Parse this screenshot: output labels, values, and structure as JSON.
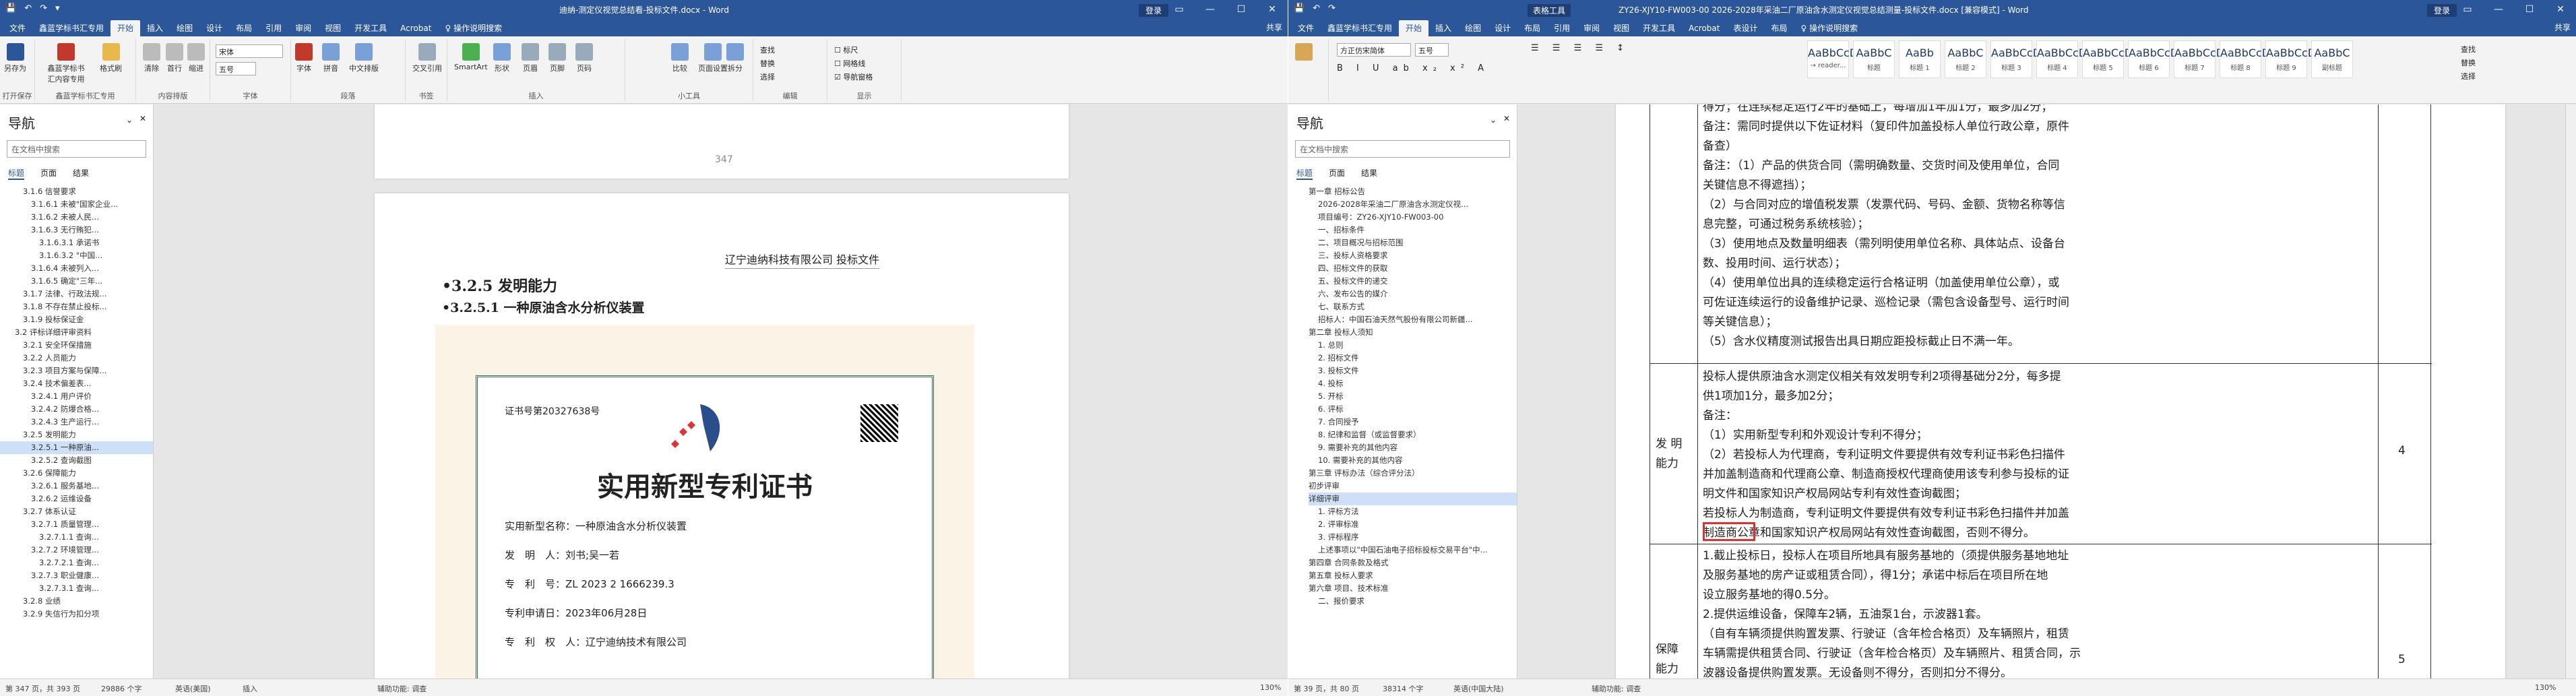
{
  "left": {
    "title": "迪纳-测定仪视觉总结看-投标文件.docx  -  Word",
    "login": "登录",
    "tabs": [
      "文件",
      "鑫蓝学标书汇专用",
      "开始",
      "插入",
      "绘图",
      "设计",
      "布局",
      "引用",
      "审阅",
      "视图",
      "开发工具",
      "Acrobat",
      "♀ 操作说明搜索"
    ],
    "share": "共享",
    "ribbon": {
      "groups": [
        "打开保存",
        "鑫蓝学标书汇专用",
        "内容排版",
        "字体",
        "段落",
        "书签",
        "插入",
        "小工具",
        "编辑",
        "显示"
      ],
      "buttons": [
        "另存为",
        "鑫蓝学标书汇内容专用",
        "格式刷",
        "清除",
        "首行",
        "缩进",
        "样式",
        "字体",
        "拼音",
        "中文排版",
        "页眉",
        "页脚",
        "页码",
        "目录",
        "比较",
        "页面设置",
        "拆分",
        "交叉引用",
        "SmartArt",
        "形状",
        "图片",
        "插图"
      ],
      "font_name": "宋体",
      "font_size": "五号",
      "find": "查找",
      "replace": "替换",
      "select": "选择",
      "show": [
        "标尺",
        "网格线",
        "导航窗格"
      ]
    },
    "nav": {
      "title": "导航",
      "search": "在文档中搜索",
      "tabs": [
        "标题",
        "页面",
        "结果"
      ],
      "items": [
        "3.1.6 信誉要求",
        "3.1.6.1 未被\"国家企业...",
        "3.1.6.2 未被人民...",
        "3.1.6.3 无行贿犯...",
        "3.1.6.3.1 承诺书",
        "3.1.6.3.2 \"中国...",
        "3.1.6.4 未被列入...",
        "3.1.6.5 确定\"三年...",
        "3.1.7 法律、行政法规...",
        "3.1.8 不存在禁止投标...",
        "3.1.9 投标保证金",
        "3.2 评标详细评审资料",
        "3.2.1 安全环保措施",
        "3.2.2 人员能力",
        "3.2.3 项目方案与保障...",
        "3.2.4 技术偏差表...",
        "3.2.4.1 用户评价",
        "3.2.4.2 防爆合格...",
        "3.2.4.3 生产运行...",
        "3.2.5 发明能力",
        "3.2.5.1 一种原油...",
        "3.2.5.2 查询截图",
        "3.2.6 保障能力",
        "3.2.6.1 服务基地...",
        "3.2.6.2 运维设备",
        "3.2.7 体系认证",
        "3.2.7.1 质量管理...",
        "3.2.7.1.1 查询...",
        "3.2.7.2 环境管理...",
        "3.2.7.2.1 查询...",
        "3.2.7.3 职业健康...",
        "3.2.7.3.1 查询...",
        "3.2.8 业绩",
        "3.2.9 失信行为扣分项"
      ]
    },
    "doc": {
      "prev_page_num": "347",
      "header": "辽宁迪纳科技有限公司        投标文件",
      "h1": "•3.2.5 发明能力",
      "h2": "•3.2.5.1 一种原油含水分析仪装置",
      "cert_no": "证书号第20327638号",
      "cert_title": "实用新型专利证书",
      "cert_lines": [
        "实用新型名称：一种原油含水分析仪装置",
        "发　明　人：刘书;吴一若",
        "专　利　号：ZL 2023 2 1666239.3",
        "专利申请日：2023年06月28日",
        "专　利　权　人：辽宁迪纳技术有限公司"
      ]
    },
    "status": [
      "第 347 页，共 393 页",
      "29886 个字",
      "英语(美国)",
      "插入",
      "辅助功能: 调查",
      "130%"
    ]
  },
  "right": {
    "title": "ZY26-XJY10-FW003-00 2026-2028年采油二厂原油含水测定仪视觉总结测量-投标文件.docx [兼容模式]  -  Word",
    "login": "登录",
    "tabs": [
      "文件",
      "鑫蓝学标书汇专用",
      "开始",
      "插入",
      "绘图",
      "设计",
      "布局",
      "引用",
      "审阅",
      "视图",
      "开发工具",
      "Acrobat",
      "表设计",
      "布局",
      "♀ 操作说明搜索"
    ],
    "context_tool": "表格工具",
    "share": "共享",
    "styles": [
      {
        "s": "AaBbCcDc",
        "n": "→ reader..."
      },
      {
        "s": "AaBbC",
        "n": "标题"
      },
      {
        "s": "AaBb",
        "n": "标题 1"
      },
      {
        "s": "AaBbC",
        "n": "标题 2"
      },
      {
        "s": "AaBbCcD",
        "n": "标题 3"
      },
      {
        "s": "AaBbCcDd",
        "n": "标题 4"
      },
      {
        "s": "AaBbCcD",
        "n": "标题 5"
      },
      {
        "s": "AaBbCcDd",
        "n": "标题 6"
      },
      {
        "s": "AaBbCcDd",
        "n": "标题 7"
      },
      {
        "s": "AaBbCcDd",
        "n": "标题 8"
      },
      {
        "s": "AaBbCcDd",
        "n": "标题 9"
      },
      {
        "s": "AaBbC",
        "n": "副标题"
      }
    ],
    "font_name": "方正仿宋简体",
    "font_size": "五号",
    "nav": {
      "title": "导航",
      "search": "在文档中搜索",
      "tabs": [
        "标题",
        "页面",
        "结果"
      ],
      "items": [
        "第一章  招标公告",
        "2026-2028年采油二厂原油含水测定仪视...",
        "项目编号：ZY26-XJY10-FW003-00",
        "一、招标条件",
        "二、项目概况与招标范围",
        "三、投标人资格要求",
        "四、招标文件的获取",
        "五、投标文件的递交",
        "六、发布公告的媒介",
        "七、联系方式",
        "招标人：中国石油天然气股份有限公司新疆...",
        "第二章  投标人须知",
        "1. 总则",
        "2. 招标文件",
        "3. 投标文件",
        "4. 投标",
        "5. 开标",
        "6. 评标",
        "7. 合同授予",
        "8. 纪律和监督（或监督要求）",
        "9. 需要补充的其他内容",
        "10. 需要补充的其他内容",
        "第三章  评标办法（综合评分法）",
        "初步评审",
        "详细评审",
        "1. 评标方法",
        "2. 评审标准",
        "3. 评标程序",
        "上述事项以\"中国石油电子招标投标交易平台\"中...",
        "第四章  合同条款及格式",
        "第五章  投标人要求",
        "第六章  项目、技术标准",
        "二、报价要求"
      ]
    },
    "table": {
      "upper": [
        "得分；在连续稳定运行2年的基础上，每增加1年加1分，最多加2分；",
        "备注：需同时提供以下佐证材料（复印件加盖投标人单位行政公章，原件",
        "备查）",
        "备注：（1）产品的供货合同（需明确数量、交货时间及使用单位，合同",
        "关键信息不得遮挡）；",
        "（2）与合同对应的增值税发票（发票代码、号码、金额、货物名称等信",
        "息完整，可通过税务系统核验）；",
        "（3）使用地点及数量明细表（需列明使用单位名称、具体站点、设备台",
        "数、投用时间、运行状态）；",
        "（4）使用单位出具的连续稳定运行合格证明（加盖使用单位公章），或",
        "可佐证连续运行的设备维护记录、巡检记录（需包含设备型号、运行时间",
        "等关键信息）；",
        "（5）含水仪精度测试报告出具日期应距投标截止日不满一年。"
      ],
      "middle_label": [
        "发 明",
        "能力"
      ],
      "middle": [
        "投标人提供原油含水测定仪相关有效发明专利2项得基础分2分，每多提",
        "供1项加1分，最多加2分；",
        "备注：",
        "（1）实用新型专利和外观设计专利不得分；",
        "（2）若投标人为代理商，专利证明文件要提供有效专利证书彩色扫描件",
        "并加盖制造商和代理商公章、制造商授权代理商使用该专利参与投标的证",
        "明文件和国家知识产权局网站专利有效性查询截图；",
        "若投标人为制造商，专利证明文件要提供有效专利证书彩色扫描件并加盖",
        "制造商公章和国家知识产权局网站有效性查询截图，否则不得分。"
      ],
      "middle_score": "4",
      "lower_label": [
        "保障",
        "能力"
      ],
      "lower": [
        "1.截止投标日，投标人在项目所地具有服务基地的（须提供服务基地地址",
        "及服务基地的房产证或租赁合同），得1分；承诺中标后在项目所在地",
        "设立服务基地的得0.5分。",
        "2.提供运维设备，保障车2辆，五油泵1台，示波器1套。",
        "（自有车辆须提供购置发票、行驶证（含年检合格页）及车辆照片，租赁",
        "车辆需提供租赁合同、行驶证（含年检合格页）及车辆照片、租赁合同，示",
        "波器设备提供购置发票。无设备则不得分，否则扣分不得分。"
      ],
      "lower_score": "5"
    },
    "status": [
      "第 39 页，共 80 页",
      "38314 个字",
      "英语(中国大陆)",
      "辅助功能: 调查",
      "130%"
    ]
  },
  "colors": {
    "brand": "#2b579a",
    "highlight": "#e03030"
  }
}
